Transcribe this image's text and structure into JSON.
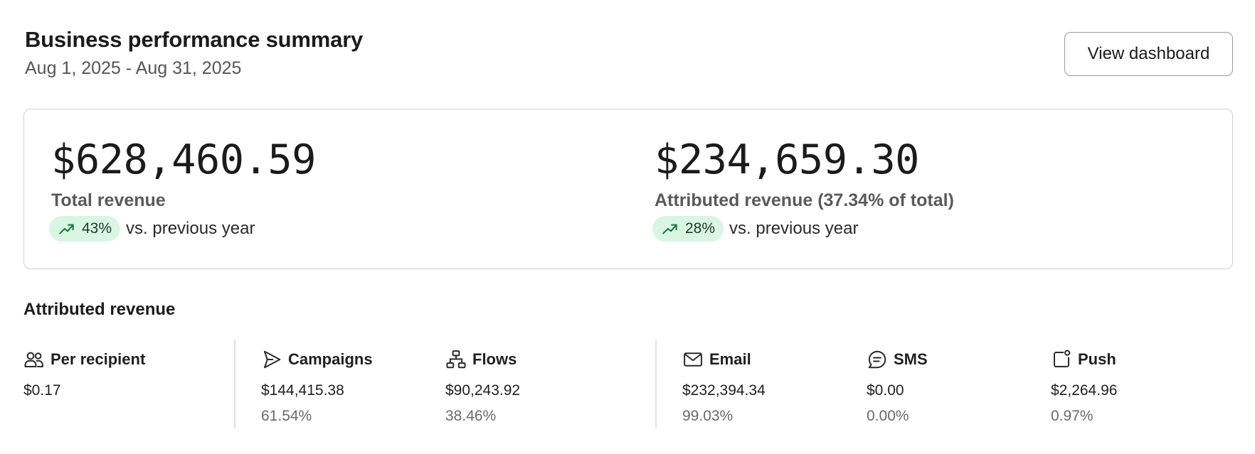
{
  "header": {
    "title": "Business performance summary",
    "date_range": "Aug 1, 2025 - Aug 31, 2025",
    "view_dashboard_label": "View dashboard"
  },
  "summary": {
    "total": {
      "value": "$628,460.59",
      "label": "Total revenue",
      "trend_icon": "trend-up-icon",
      "trend_pct": "43%",
      "trend_text": "vs. previous year"
    },
    "attributed": {
      "value": "$234,659.30",
      "label": "Attributed revenue (37.34% of total)",
      "trend_icon": "trend-up-icon",
      "trend_pct": "28%",
      "trend_text": "vs. previous year"
    }
  },
  "attributed_section": {
    "title": "Attributed revenue",
    "stats": [
      {
        "icon": "users-icon",
        "name": "Per recipient",
        "value": "$0.17",
        "pct": ""
      },
      {
        "icon": "send-icon",
        "name": "Campaigns",
        "value": "$144,415.38",
        "pct": "61.54%"
      },
      {
        "icon": "flow-icon",
        "name": "Flows",
        "value": "$90,243.92",
        "pct": "38.46%"
      },
      {
        "icon": "mail-icon",
        "name": "Email",
        "value": "$232,394.34",
        "pct": "99.03%"
      },
      {
        "icon": "sms-icon",
        "name": "SMS",
        "value": "$0.00",
        "pct": "0.00%"
      },
      {
        "icon": "push-icon",
        "name": "Push",
        "value": "$2,264.96",
        "pct": "0.97%"
      }
    ]
  },
  "colors": {
    "trend_badge_bg": "#d9f6e2",
    "trend_icon": "#1a7f45",
    "text_primary": "#1b1b1b",
    "text_secondary": "#555555"
  }
}
